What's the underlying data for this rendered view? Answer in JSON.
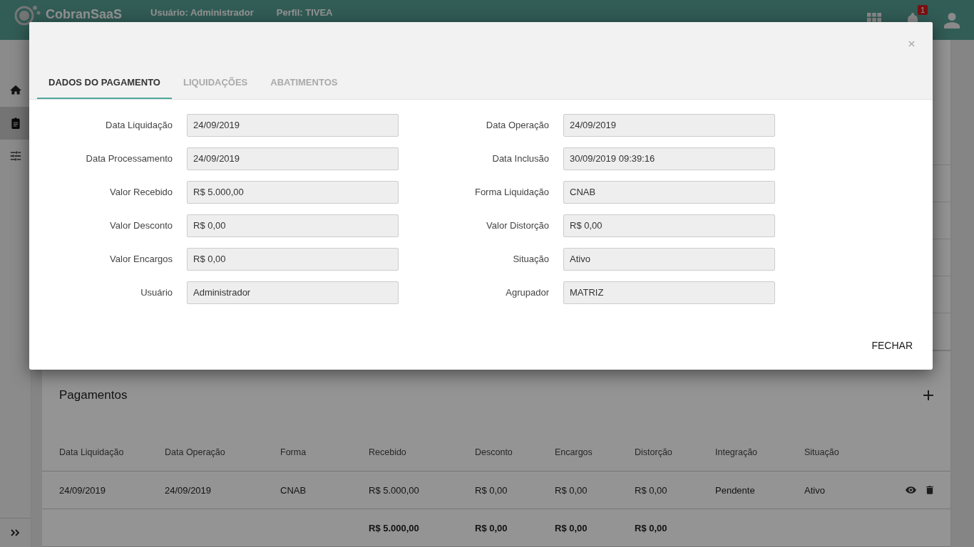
{
  "app": {
    "logo": "CobranSaaS",
    "user_label": "Usuário:",
    "user": "Administrador",
    "profile_label": "Perfil:",
    "profile": "TIVEA",
    "notifications": "1"
  },
  "sidebar": {
    "items": [
      {
        "kind": "home",
        "selected": false
      },
      {
        "kind": "clipboard",
        "selected": true
      },
      {
        "kind": "tune",
        "selected": false
      }
    ]
  },
  "pagamentos": {
    "title": "Pagamentos",
    "columns": [
      "Data Liquidação",
      "Data Operação",
      "Forma",
      "Recebido",
      "Desconto",
      "Encargos",
      "Distorção",
      "Integração",
      "Situação"
    ],
    "rows": [
      {
        "cells": [
          "24/09/2019",
          "24/09/2019",
          "CNAB",
          "R$ 5.000,00",
          "R$ 0,00",
          "R$ 0,00",
          "R$ 0,00",
          "Pendente",
          "Ativo"
        ]
      }
    ],
    "totals": {
      "recebido": "R$ 5.000,00",
      "desconto": "R$ 0,00",
      "encargos": "R$ 0,00",
      "distorcao": "R$ 0,00"
    }
  },
  "modal": {
    "tabs": [
      {
        "label": "DADOS DO PAGAMENTO",
        "selected": true
      },
      {
        "label": "LIQUIDAÇÕES",
        "selected": false
      },
      {
        "label": "ABATIMENTOS",
        "selected": false
      }
    ],
    "fields_left": [
      {
        "label": "Data Liquidação",
        "value": "24/09/2019"
      },
      {
        "label": "Data Processamento",
        "value": "24/09/2019"
      },
      {
        "label": "Valor Recebido",
        "value": "R$ 5.000,00"
      },
      {
        "label": "Valor Desconto",
        "value": "R$ 0,00"
      },
      {
        "label": "Valor Encargos",
        "value": "R$ 0,00"
      },
      {
        "label": "Usuário",
        "value": "Administrador"
      }
    ],
    "fields_right": [
      {
        "label": "Data Operação",
        "value": "24/09/2019"
      },
      {
        "label": "Data Inclusão",
        "value": "30/09/2019 09:39:16"
      },
      {
        "label": "Forma Liquidação",
        "value": "CNAB"
      },
      {
        "label": "Valor Distorção",
        "value": "R$ 0,00"
      },
      {
        "label": "Situação",
        "value": "Ativo"
      },
      {
        "label": "Agrupador",
        "value": "MATRIZ"
      }
    ],
    "close_button": "FECHAR"
  }
}
